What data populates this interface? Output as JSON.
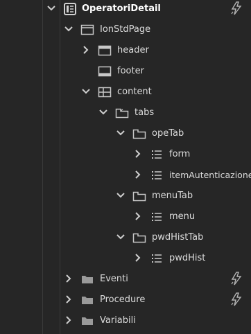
{
  "tree": {
    "root": {
      "label": "OperatoriDetail",
      "icon": "page-icon",
      "expanded": true,
      "badge": "lightning-icon"
    },
    "page": {
      "label": "IonStdPage",
      "icon": "window-icon",
      "expanded": true
    },
    "header": {
      "label": "header",
      "icon": "header-icon",
      "expanded": false
    },
    "footer": {
      "label": "footer",
      "icon": "footer-icon"
    },
    "content": {
      "label": "content",
      "icon": "layout-grid-icon",
      "expanded": true
    },
    "tabs": {
      "label": "tabs",
      "icon": "tabs-icon",
      "expanded": true
    },
    "opeTab": {
      "label": "opeTab",
      "icon": "tab-icon",
      "expanded": true
    },
    "form": {
      "label": "form",
      "icon": "list-icon",
      "expanded": false
    },
    "itemAutenticazione": {
      "label": "itemAutenticazione",
      "icon": "list-icon",
      "expanded": false
    },
    "menuTab": {
      "label": "menuTab",
      "icon": "tab-icon",
      "expanded": true
    },
    "menu": {
      "label": "menu",
      "icon": "list-icon",
      "expanded": false
    },
    "pwdHistTab": {
      "label": "pwdHistTab",
      "icon": "tab-icon",
      "expanded": true
    },
    "pwdHist": {
      "label": "pwdHist",
      "icon": "list-icon",
      "expanded": false
    },
    "eventi": {
      "label": "Eventi",
      "icon": "folder-icon",
      "expanded": false,
      "badge": "lightning-icon"
    },
    "procedure": {
      "label": "Procedure",
      "icon": "folder-icon",
      "expanded": false,
      "badge": "lightning-icon"
    },
    "variabili": {
      "label": "Variabili",
      "icon": "folder-icon",
      "expanded": false
    }
  },
  "colors": {
    "background": "#262626",
    "text": "#dcdcdc",
    "icon": "#bdbdbd",
    "gutter_line": "#3a3a3a"
  }
}
